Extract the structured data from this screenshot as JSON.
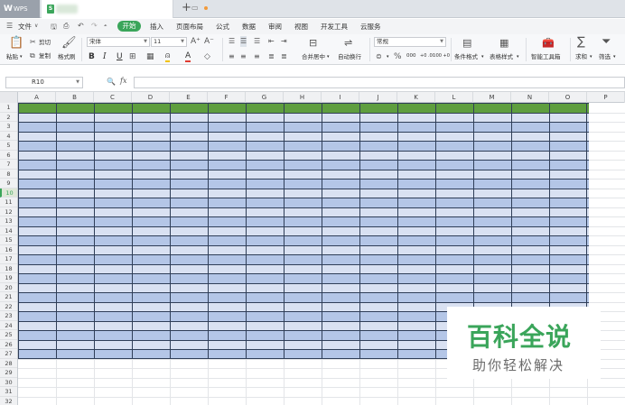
{
  "titlebar": {
    "app_logo": "W",
    "app_name": "WPS",
    "doc_icon": "S",
    "new_tab": "+"
  },
  "menubar": {
    "file": "文件",
    "items": [
      "开始",
      "插入",
      "页面布局",
      "公式",
      "数据",
      "审阅",
      "视图",
      "开发工具",
      "云服务"
    ]
  },
  "ribbon": {
    "paste": "粘贴",
    "cut": "剪切",
    "copy": "复制",
    "format_painter": "格式刷",
    "font_name": "宋体",
    "font_size": "11",
    "number_format": "常规",
    "merge_center": "合并居中",
    "wrap_text": "自动换行",
    "conditional_format": "条件格式",
    "table_style": "表格样式",
    "smart_toolbox": "智能工具箱",
    "sum": "求和",
    "filter": "筛选",
    "percent": "%",
    "thousands": "000",
    "dec_inc": "+0 .00",
    "dec_dec": ".00 +0"
  },
  "formulabar": {
    "cell_ref": "R10",
    "fx": "fx"
  },
  "grid": {
    "columns": [
      "A",
      "B",
      "C",
      "D",
      "E",
      "F",
      "G",
      "H",
      "I",
      "J",
      "K",
      "L",
      "M",
      "N",
      "O",
      "P"
    ],
    "rows": [
      "1",
      "2",
      "3",
      "4",
      "5",
      "6",
      "7",
      "8",
      "9",
      "10",
      "11",
      "12",
      "13",
      "14",
      "15",
      "16",
      "17",
      "18",
      "19",
      "20",
      "21",
      "22",
      "23",
      "24",
      "25",
      "26",
      "27",
      "28",
      "29",
      "30",
      "31",
      "32"
    ],
    "active_row": "10",
    "table_header_color": "#5e9e3f",
    "table_band_colors": [
      "#b4c6e7",
      "#d9e1f2"
    ],
    "table_border_color": "#2f3e58"
  },
  "watermark": {
    "title": "百科全说",
    "subtitle": "助你轻松解决",
    "title_color": "#3aa55a"
  }
}
